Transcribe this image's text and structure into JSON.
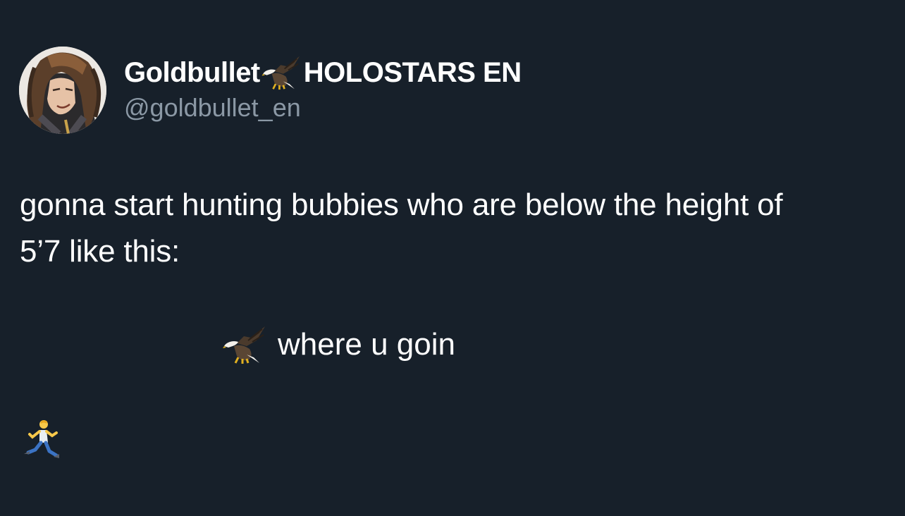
{
  "tweet": {
    "author": {
      "display_name": "Goldbullet",
      "display_name_suffix": "HOLOSTARS EN",
      "name_emoji": "eagle-icon",
      "handle": "@goldbullet_en"
    },
    "text_line1": "gonna start hunting bubbies who are below the height of",
    "text_line2": "5’7 like this:",
    "eagle_line_text": "where u goin",
    "eagle_emoji": "eagle-icon",
    "runner_emoji": "person-running-icon"
  },
  "colors": {
    "background": "#17202a",
    "text_primary": "#ffffff",
    "text_secondary": "#8b98a5"
  }
}
